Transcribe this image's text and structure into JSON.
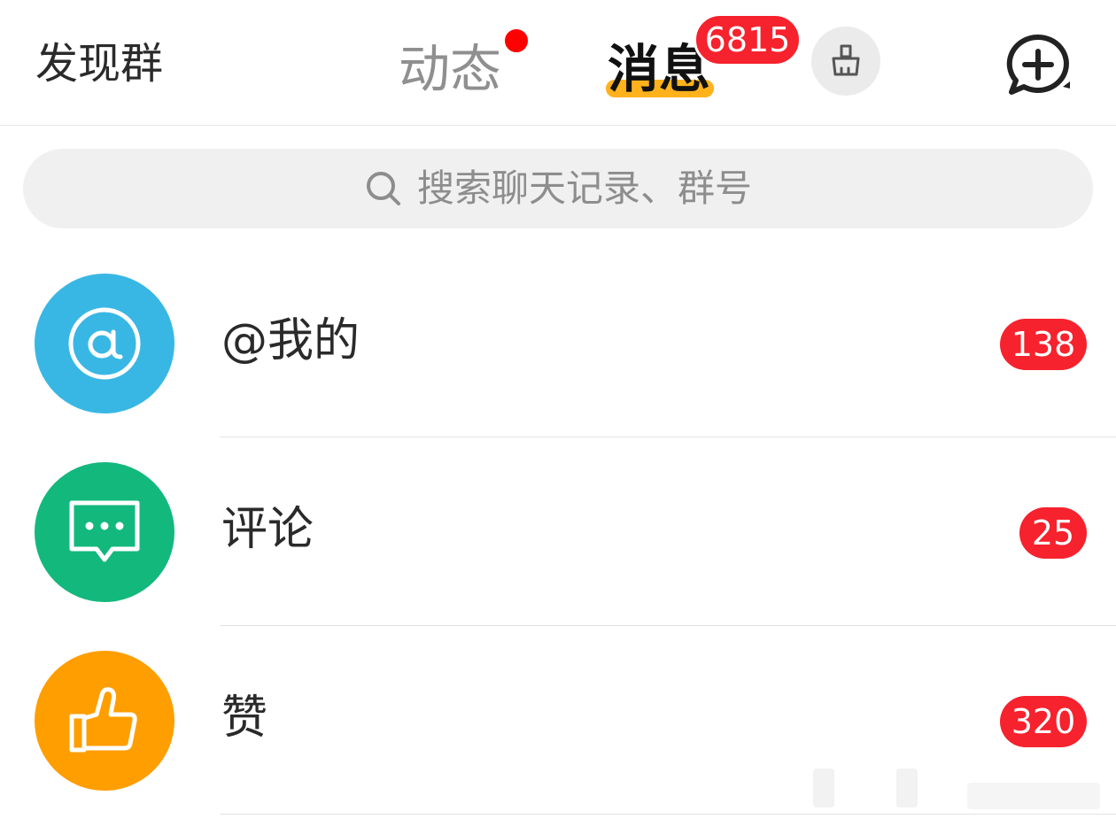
{
  "header": {
    "discover_label": "发现群",
    "tabs": [
      {
        "label": "动态",
        "active": false,
        "has_dot": true
      },
      {
        "label": "消息",
        "active": true
      }
    ],
    "message_count": "6815",
    "clean_icon": "broom-icon",
    "add_icon": "chat-plus-icon"
  },
  "search": {
    "placeholder": "搜索聊天记录、群号",
    "icon": "search-icon"
  },
  "list": [
    {
      "label": "@我的",
      "badge": "138",
      "icon": "at-icon",
      "color": "#39b7e4"
    },
    {
      "label": "评论",
      "badge": "25",
      "icon": "comment-icon",
      "color": "#13b87d"
    },
    {
      "label": "赞",
      "badge": "320",
      "icon": "thumbs-up-icon",
      "color": "#ff9e00"
    }
  ],
  "colors": {
    "accent_underline": "#ffb21c",
    "badge_red": "#f6222d"
  }
}
